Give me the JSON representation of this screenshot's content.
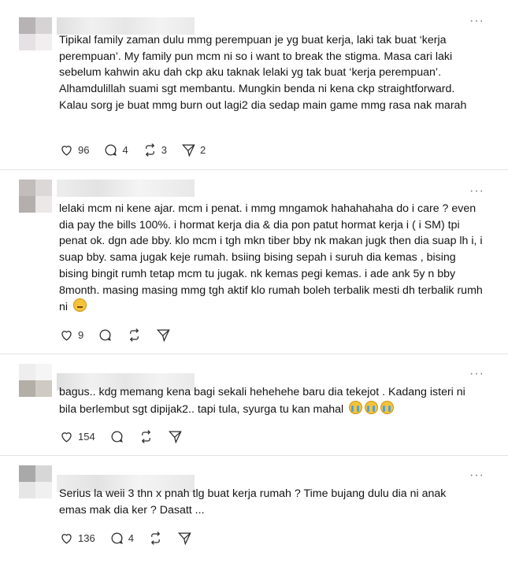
{
  "posts": [
    {
      "text": "Tipikal family zaman dulu mmg perempuan je yg buat kerja, laki tak buat ‘kerja perempuan’. My family pun mcm ni so i want to break the stigma. Masa cari laki sebelum kahwin aku dah ckp aku taknak lelaki yg tak buat ‘kerja perempuan’. Alhamdulillah suami sgt membantu. Mungkin benda ni kena ckp straightforward. Kalau sorg je buat mmg burn out lagi2 dia sedap main game mmg rasa nak marah",
      "likes": "96",
      "replies": "4",
      "reposts": "3",
      "shares": "2"
    },
    {
      "text": "lelaki mcm ni kene ajar. mcm i penat. i mmg mngamok hahahahaha do i care ? even dia pay the bills 100%. i hormat kerja dia & dia pon patut hormat kerja i ( i SM) tpi penat ok. dgn ade bby. klo mcm i tgh mkn tiber bby nk makan jugk then dia suap lh i, i suap bby. sama jugak keje rumah. bsiing bising sepah i suruh dia kemas , bising bising bingit rumh tetap mcm tu jugak. nk kemas pegi kemas. i ade ank 5y n bby 8month. masing masing mmg tgh aktif klo rumah boleh terbalik mesti dh terbalik rumh ni",
      "likes": "9",
      "replies": "",
      "reposts": "",
      "shares": ""
    },
    {
      "text": "bagus.. kdg memang kena bagi sekali hehehehe baru dia tekejot . Kadang isteri ni bila berlembut sgt dipijak2.. tapi tula, syurga tu kan mahal",
      "likes": "154",
      "replies": "",
      "reposts": "",
      "shares": ""
    },
    {
      "text": "Serius la weii 3 thn x pnah tlg buat kerja rumah ? Time bujang dulu dia ni anak emas mak dia ker ? Dasatt ...",
      "likes": "136",
      "replies": "4",
      "reposts": "",
      "shares": ""
    }
  ],
  "icons": {
    "more": "more-options-icon",
    "like": "heart-icon",
    "reply": "comment-icon",
    "repost": "repost-icon",
    "share": "share-send-icon",
    "emoji_cry": "loudly-crying-face-emoji",
    "emoji_flat": "expressionless-face-emoji"
  },
  "more_label": "···"
}
